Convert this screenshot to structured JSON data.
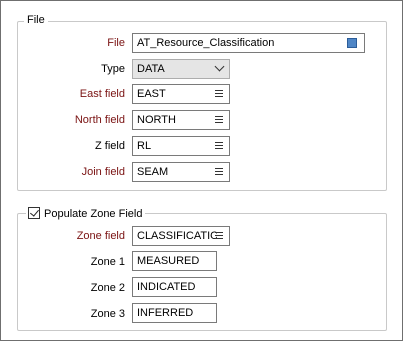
{
  "file_group": {
    "title": "File",
    "file_label": "File",
    "file_value": "AT_Resource_Classification",
    "type_label": "Type",
    "type_value": "DATA",
    "east_label": "East field",
    "east_value": "EAST",
    "north_label": "North field",
    "north_value": "NORTH",
    "z_label": "Z field",
    "z_value": "RL",
    "join_label": "Join field",
    "join_value": "SEAM"
  },
  "zone_group": {
    "title": "Populate Zone Field",
    "checked": true,
    "zone_field_label": "Zone field",
    "zone_field_value": "CLASSIFICATIO",
    "zone1_label": "Zone 1",
    "zone1_value": "MEASURED",
    "zone2_label": "Zone 2",
    "zone2_value": "INDICATED",
    "zone3_label": "Zone 3",
    "zone3_value": "INFERRED"
  },
  "colors": {
    "required_label": "#7a1212",
    "browse_icon": "#4f86c6"
  }
}
